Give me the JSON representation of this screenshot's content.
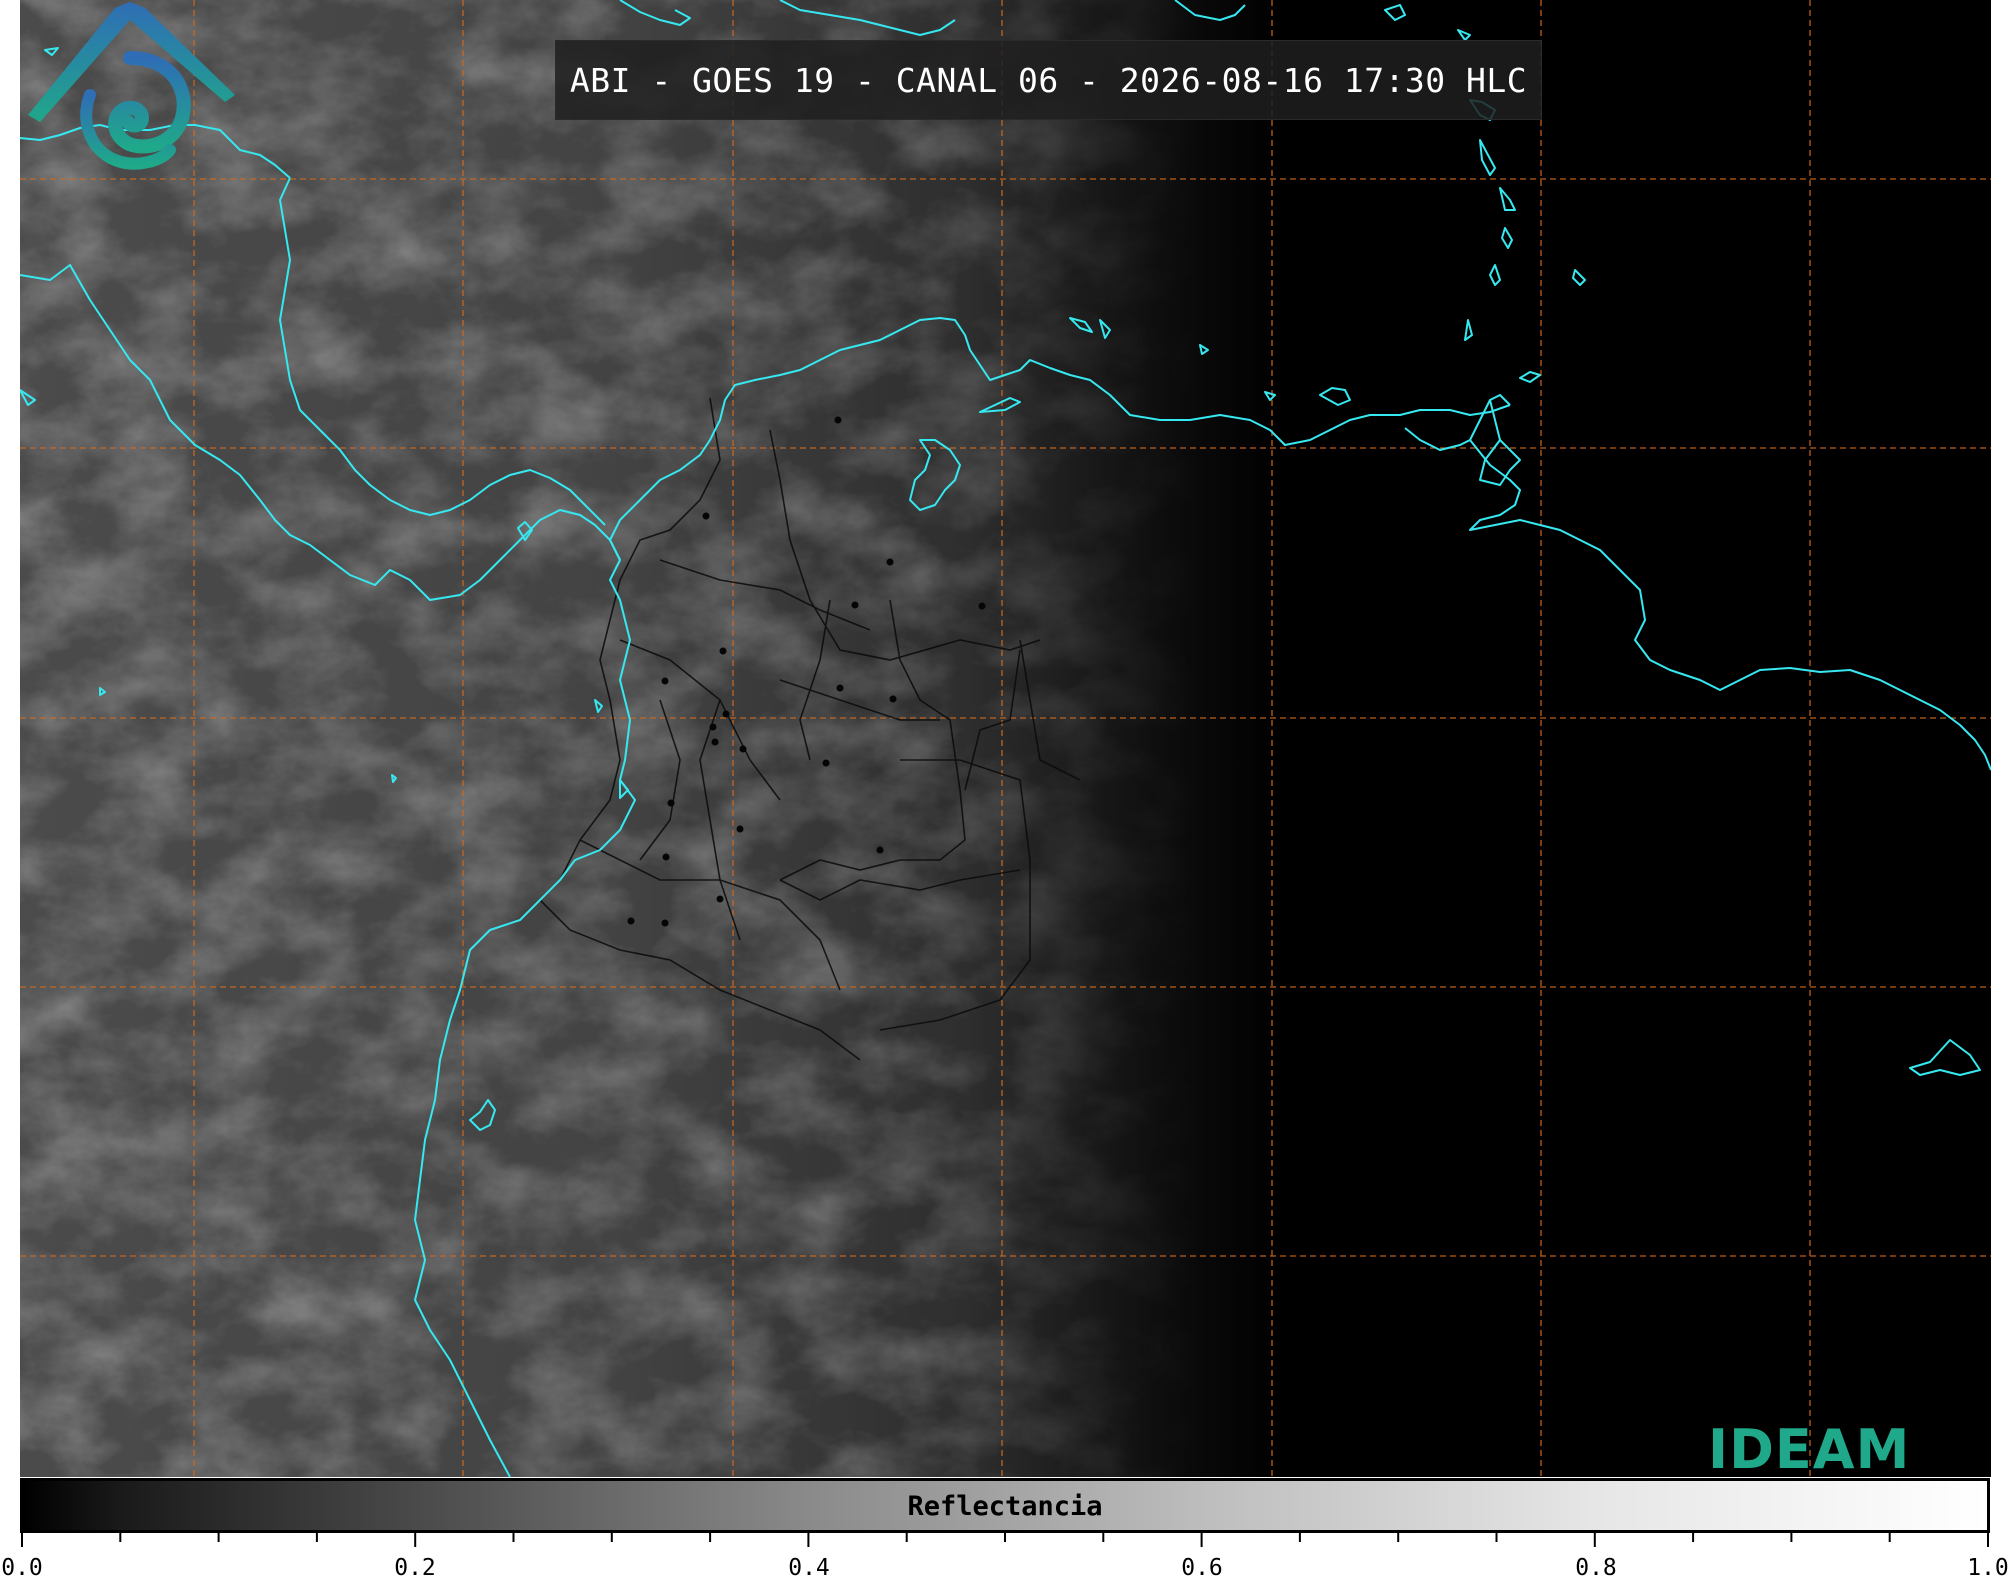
{
  "title": "ABI - GOES 19 - CANAL 06 - 2026-08-16 17:30 HLC",
  "logo": {
    "text": "IDEAM",
    "icon": "ideam-logo-icon"
  },
  "colorbar": {
    "label": "Reflectancia",
    "tick_labels": [
      "0.0",
      "0.2",
      "0.4",
      "0.6",
      "0.8",
      "1.0"
    ],
    "range": [
      0.0,
      1.0
    ],
    "major_step": 0.2,
    "minor_step": 0.05
  },
  "colors": {
    "coastline": "#36e8f0",
    "grid": "#d2691e",
    "borders": "#000000",
    "logo_blue": "#2f6db6",
    "logo_green": "#1fa88a"
  }
}
